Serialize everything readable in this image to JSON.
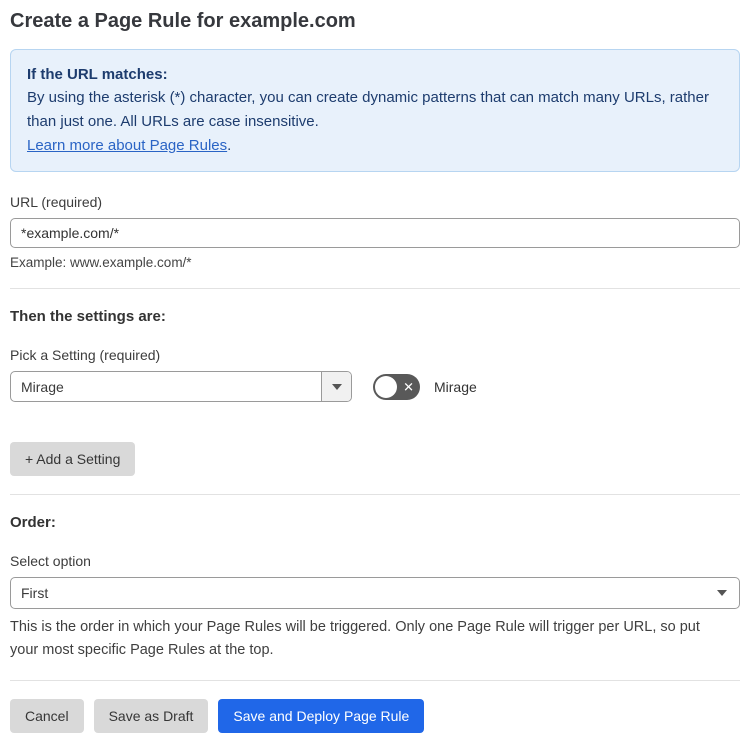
{
  "page": {
    "title": "Create a Page Rule for example.com"
  },
  "info_box": {
    "heading": "If the URL matches:",
    "body": "By using the asterisk (*) character, you can create dynamic patterns that can match many URLs, rather than just one. All URLs are case insensitive.",
    "link_label": "Learn more about Page Rules",
    "link_suffix": "."
  },
  "url_field": {
    "label": "URL (required)",
    "value": "*example.com/*",
    "helper": "Example: www.example.com/*"
  },
  "settings_section": {
    "heading": "Then the settings are:",
    "setting_label": "Pick a Setting (required)",
    "setting_value": "Mirage",
    "toggle": {
      "state": "off",
      "label": "Mirage",
      "off_glyph": "✕"
    },
    "add_button_label": "+ Add a Setting"
  },
  "order_section": {
    "heading": "Order:",
    "label": "Select option",
    "value": "First",
    "helper": "This is the order in which your Page Rules will be triggered. Only one Page Rule will trigger per URL, so put your most specific Page Rules at the top."
  },
  "actions": {
    "cancel": "Cancel",
    "save_draft": "Save as Draft",
    "save_deploy": "Save and Deploy Page Rule"
  },
  "colors": {
    "info_bg": "#e8f1fb",
    "info_border": "#b7d5f1",
    "info_text": "#1d3c6e",
    "link": "#2a64c5",
    "primary_button": "#2067e8",
    "toggle_off_bg": "#595959",
    "gray_button": "#d9d9d9"
  }
}
